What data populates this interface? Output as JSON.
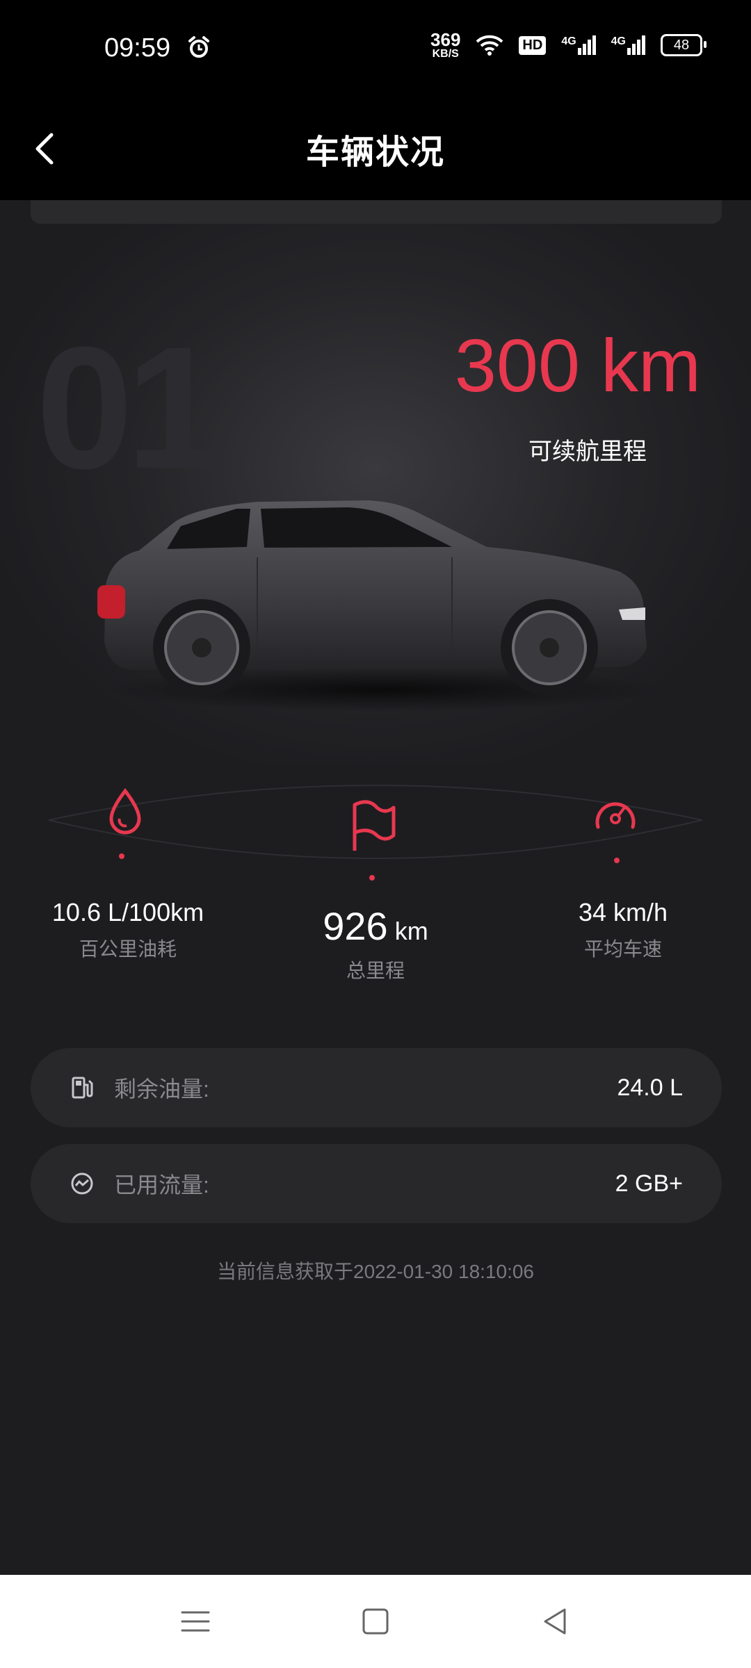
{
  "status_bar": {
    "time": "09:59",
    "net_speed_value": "369",
    "net_speed_unit": "KB/S",
    "hd_label": "HD",
    "signal1_label": "4G",
    "signal2_label": "4G",
    "battery": "48"
  },
  "header": {
    "title": "车辆状况"
  },
  "hero": {
    "watermark": "01",
    "range_value": "300 km",
    "range_label": "可续航里程"
  },
  "stats": {
    "fuel_consumption": {
      "value": "10.6",
      "unit": "L/100km",
      "label": "百公里油耗"
    },
    "total_mileage": {
      "value": "926",
      "unit": "km",
      "label": "总里程"
    },
    "avg_speed": {
      "value": "34",
      "unit": "km/h",
      "label": "平均车速"
    }
  },
  "info": {
    "fuel_remaining": {
      "label": "剩余油量:",
      "value": "24.0 L"
    },
    "data_used": {
      "label": "已用流量:",
      "value": "2 GB+"
    }
  },
  "timestamp": "当前信息获取于2022-01-30 18:10:06",
  "colors": {
    "accent": "#e8384f",
    "background": "#1d1d20",
    "card": "#28282b"
  },
  "icons": {
    "fuel_consumption": "drop-icon",
    "total_mileage": "flag-icon",
    "avg_speed": "speedometer-icon",
    "fuel_remaining": "gas-pump-icon",
    "data_used": "data-trend-icon"
  }
}
